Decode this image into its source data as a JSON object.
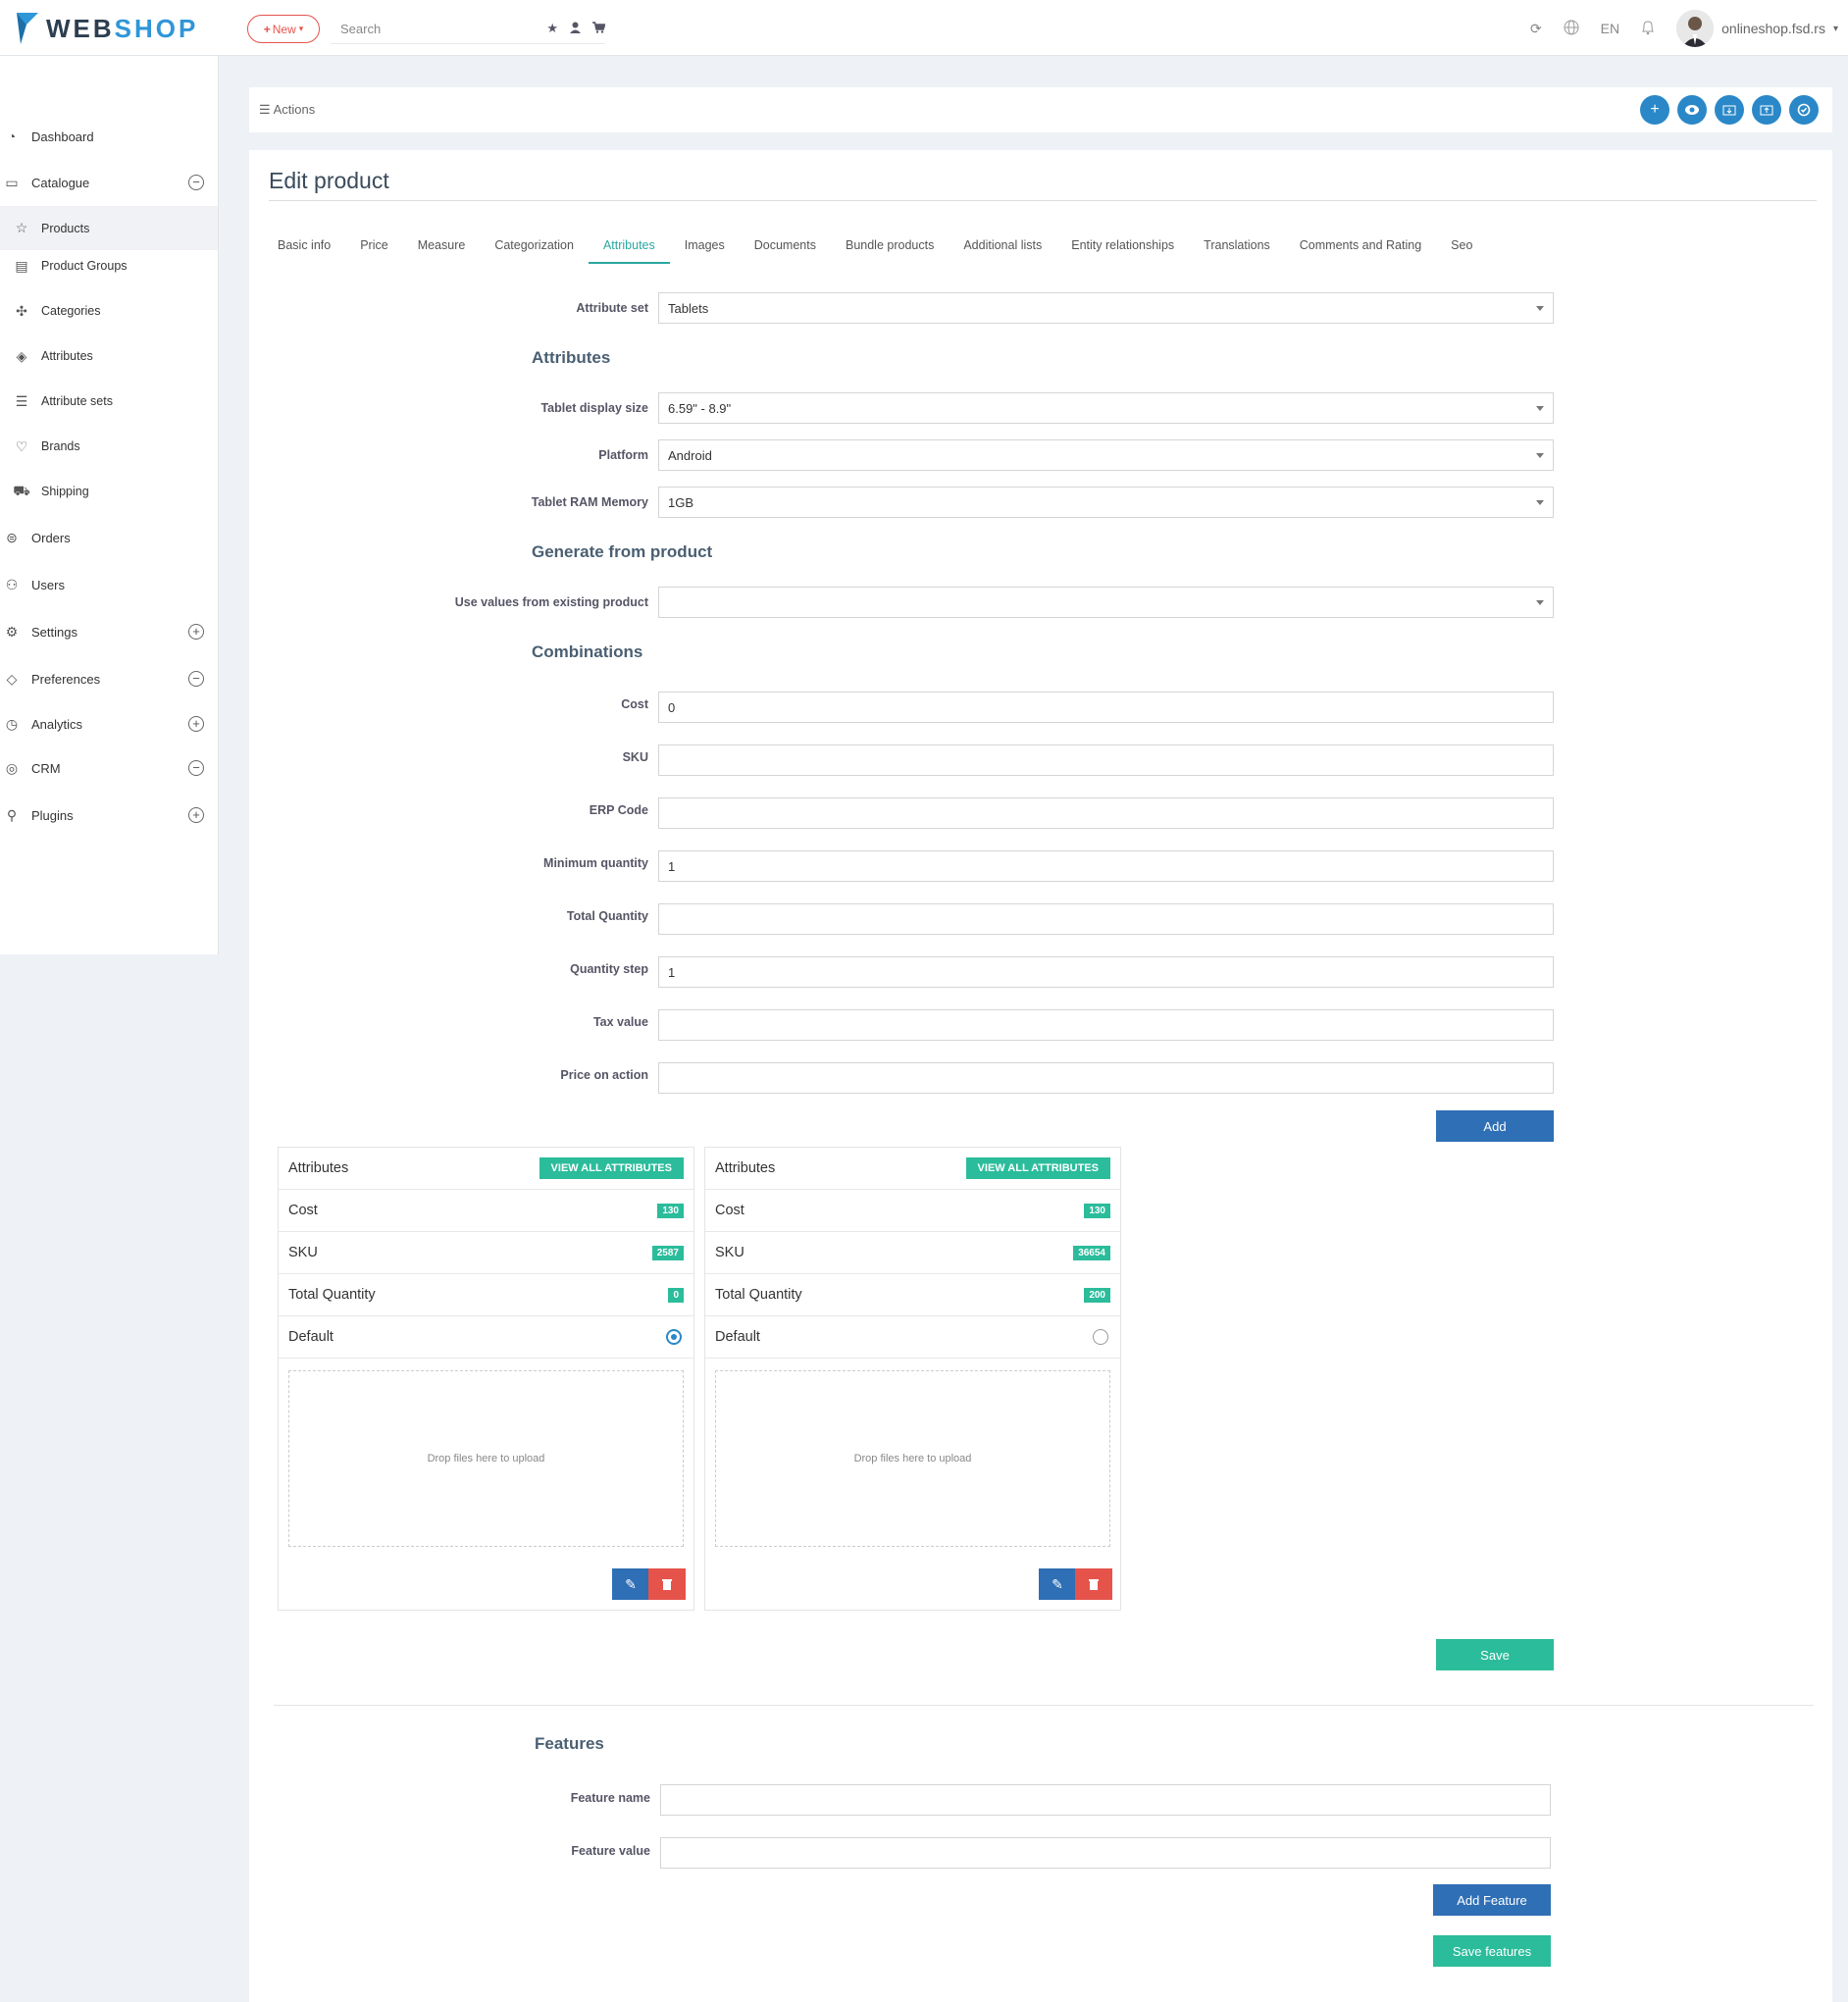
{
  "header": {
    "logo_web": "WEB",
    "logo_shop": "SHOP",
    "new_label": "New",
    "search_placeholder": "Search",
    "language": "EN",
    "user": "onlineshop.fsd.rs"
  },
  "sidebar": {
    "items": [
      {
        "label": "Dashboard",
        "icon": "dashboard-icon"
      },
      {
        "label": "Catalogue",
        "icon": "folder-icon"
      },
      {
        "label": "Products",
        "icon": "star-icon"
      },
      {
        "label": "Product Groups",
        "icon": "tag-icon"
      },
      {
        "label": "Categories",
        "icon": "network-icon"
      },
      {
        "label": "Attributes",
        "icon": "layers-icon"
      },
      {
        "label": "Attribute sets",
        "icon": "list-icon"
      },
      {
        "label": "Brands",
        "icon": "heart-icon"
      },
      {
        "label": "Shipping",
        "icon": "truck-icon"
      },
      {
        "label": "Orders",
        "icon": "orders-icon"
      },
      {
        "label": "Users",
        "icon": "users-icon"
      },
      {
        "label": "Settings",
        "icon": "gear-icon"
      },
      {
        "label": "Preferences",
        "icon": "diamond-icon"
      },
      {
        "label": "Analytics",
        "icon": "pie-icon"
      },
      {
        "label": "CRM",
        "icon": "crm-icon"
      },
      {
        "label": "Plugins",
        "icon": "plugins-icon"
      }
    ]
  },
  "actions": {
    "label": "Actions"
  },
  "page": {
    "title": "Edit product"
  },
  "tabs": [
    "Basic info",
    "Price",
    "Measure",
    "Categorization",
    "Attributes",
    "Images",
    "Documents",
    "Bundle products",
    "Additional lists",
    "Entity relationships",
    "Translations",
    "Comments and Rating",
    "Seo"
  ],
  "form": {
    "attribute_set_label": "Attribute set",
    "attribute_set_value": "Tablets",
    "attributes_heading": "Attributes",
    "display_size_label": "Tablet display size",
    "display_size_value": "6.59\" - 8.9\"",
    "platform_label": "Platform",
    "platform_value": "Android",
    "ram_label": "Tablet RAM Memory",
    "ram_value": "1GB",
    "generate_heading": "Generate from product",
    "use_values_label": "Use values from existing product",
    "use_values_value": "",
    "combinations_heading": "Combinations",
    "cost_label": "Cost",
    "cost_value": "0",
    "sku_label": "SKU",
    "sku_value": "",
    "erp_label": "ERP Code",
    "erp_value": "",
    "minqty_label": "Minimum quantity",
    "minqty_value": "1",
    "totalqty_label": "Total Quantity",
    "totalqty_value": "",
    "qtystep_label": "Quantity step",
    "qtystep_value": "1",
    "tax_label": "Tax value",
    "tax_value": "",
    "price_action_label": "Price on action",
    "price_action_value": "",
    "add_button": "Add"
  },
  "combinations": [
    {
      "header": "Attributes",
      "view_all": "VIEW ALL ATTRIBUTES",
      "cost_label": "Cost",
      "cost": "130",
      "sku_label": "SKU",
      "sku": "2587",
      "qty_label": "Total Quantity",
      "qty": "0",
      "default_label": "Default",
      "default": true,
      "drop_text": "Drop files here to upload"
    },
    {
      "header": "Attributes",
      "view_all": "VIEW ALL ATTRIBUTES",
      "cost_label": "Cost",
      "cost": "130",
      "sku_label": "SKU",
      "sku": "36654",
      "qty_label": "Total Quantity",
      "qty": "200",
      "default_label": "Default",
      "default": false,
      "drop_text": "Drop files here to upload"
    }
  ],
  "save_button": "Save",
  "features": {
    "heading": "Features",
    "name_label": "Feature name",
    "name_value": "",
    "value_label": "Feature value",
    "value_value": "",
    "add_button": "Add Feature",
    "save_button": "Save features"
  },
  "colors": {
    "accent": "#2bbc9b",
    "primary": "#2f6fb5",
    "danger": "#e5534b",
    "circle": "#2a88c8"
  }
}
